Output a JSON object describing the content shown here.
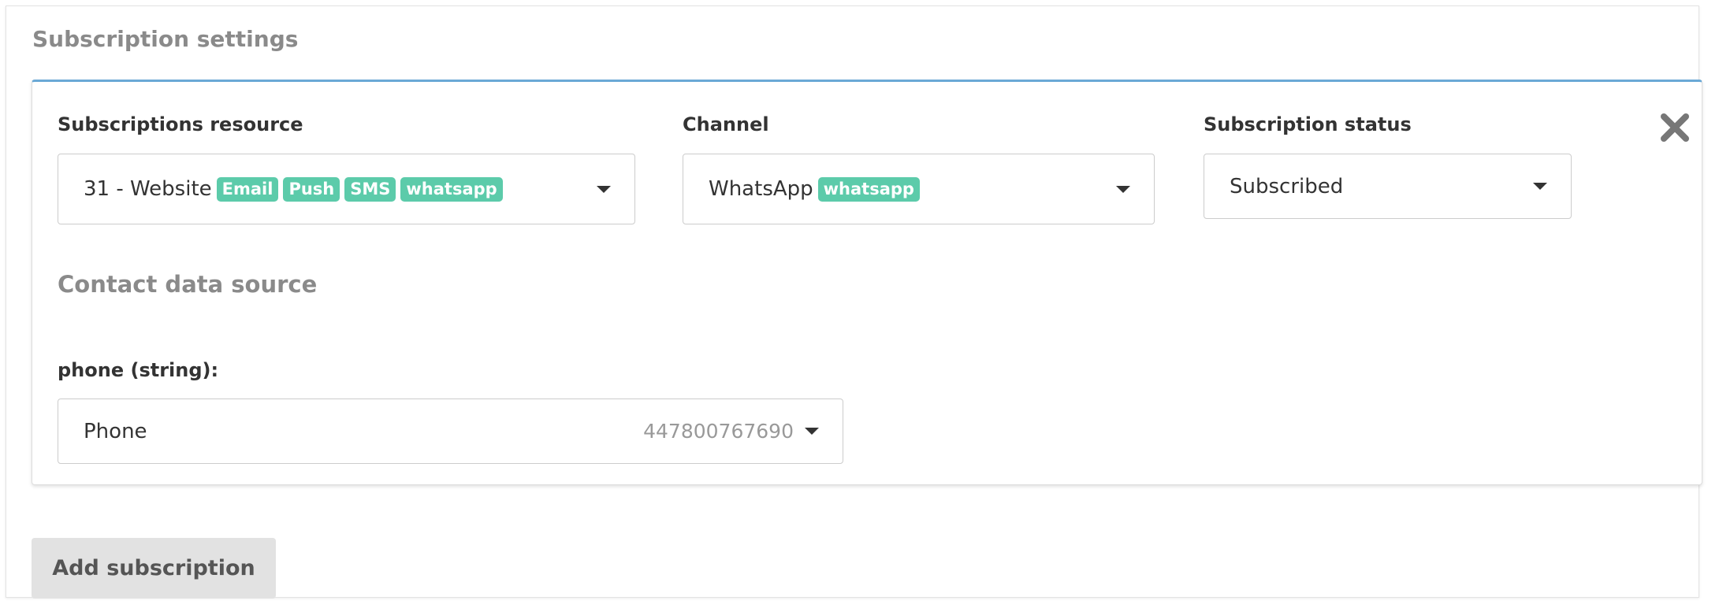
{
  "section": {
    "title": "Subscription settings"
  },
  "subscription": {
    "resource": {
      "label": "Subscriptions resource",
      "value": "31 - Website",
      "tags": [
        "Email",
        "Push",
        "SMS",
        "whatsapp"
      ]
    },
    "channel": {
      "label": "Channel",
      "value": "WhatsApp",
      "tags": [
        "whatsapp"
      ]
    },
    "status": {
      "label": "Subscription status",
      "value": "Subscribed"
    },
    "remove_icon": "close-icon"
  },
  "contact": {
    "title": "Contact data source",
    "phone": {
      "label": "phone (string):",
      "value": "Phone",
      "sample": "447800767690"
    }
  },
  "actions": {
    "add_label": "Add subscription"
  },
  "colors": {
    "tag": "#5ccbaa",
    "card_accent": "#6aa9d6",
    "button_bg": "#e2e2e2"
  }
}
